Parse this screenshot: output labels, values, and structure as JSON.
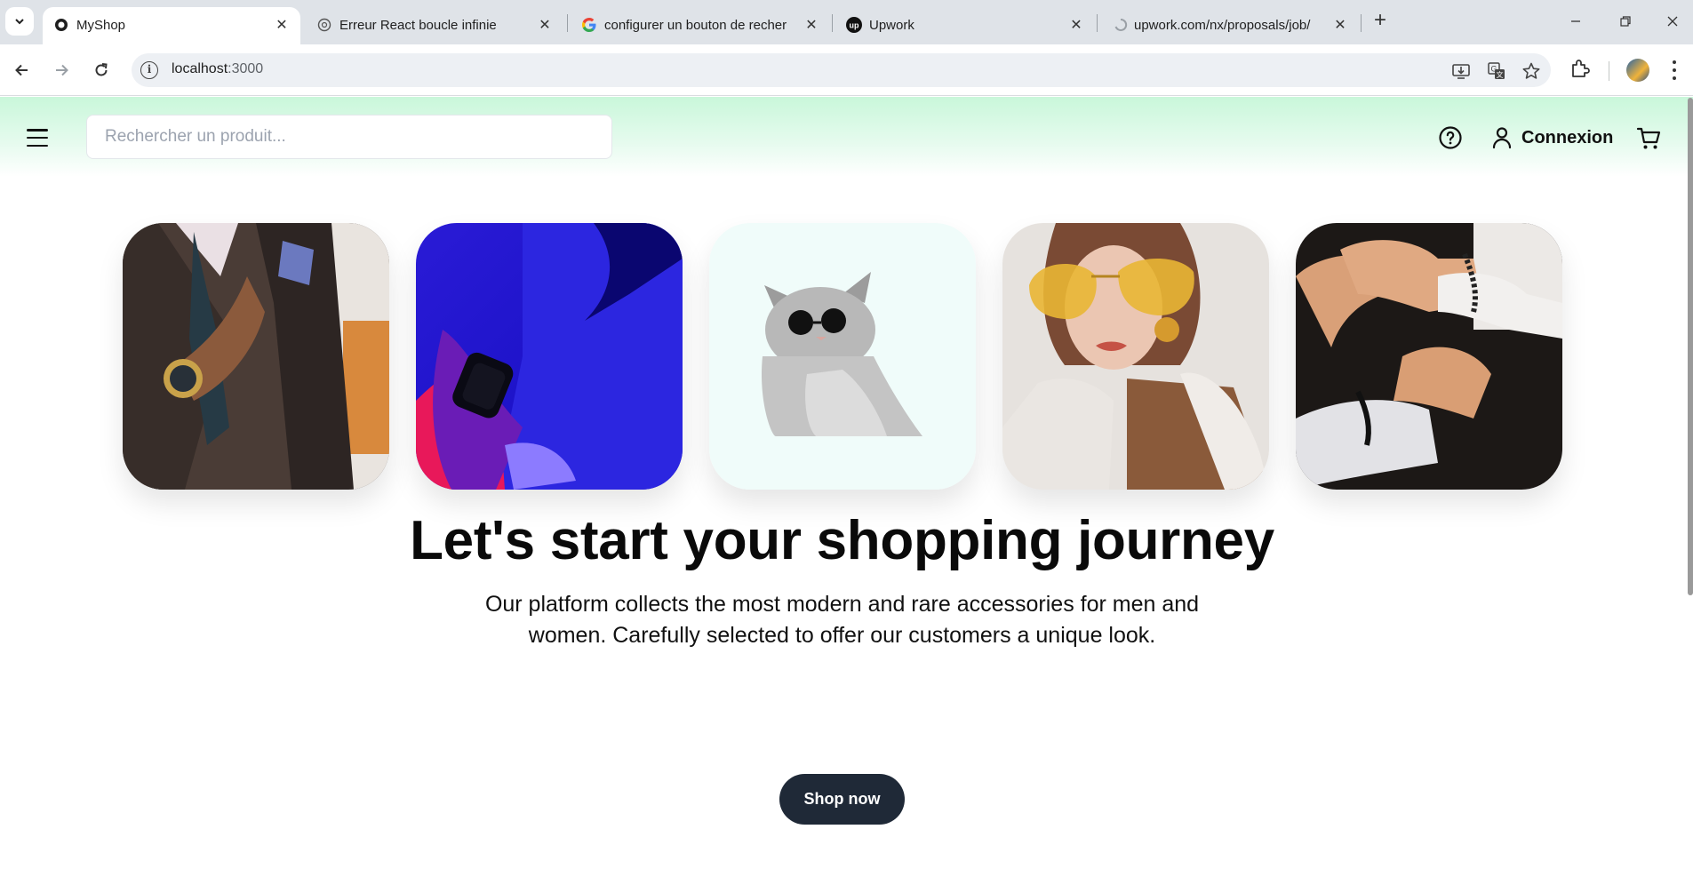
{
  "browser": {
    "tabs": [
      {
        "title": "MyShop",
        "active": true,
        "favicon": "myshop-favicon"
      },
      {
        "title": "Erreur React boucle infinie",
        "active": false,
        "favicon": "chatgpt-favicon"
      },
      {
        "title": "configurer un bouton de recher",
        "active": false,
        "favicon": "google-favicon"
      },
      {
        "title": "Upwork",
        "active": false,
        "favicon": "upwork-favicon"
      },
      {
        "title": "upwork.com/nx/proposals/job/",
        "active": false,
        "favicon": "loading-favicon"
      }
    ],
    "url_host": "localhost",
    "url_port": ":3000"
  },
  "header": {
    "search_placeholder": "Rechercher un produit...",
    "login_label": "Connexion"
  },
  "cards": [
    {
      "subject": "man in suit wearing wristwatch"
    },
    {
      "subject": "smartwatch in blue neon light"
    },
    {
      "subject": "cat wearing sunglasses"
    },
    {
      "subject": "woman with yellow sunglasses"
    },
    {
      "subject": "hands adjusting bracelets"
    }
  ],
  "hero": {
    "title": "Let's start your shopping journey",
    "subtitle": "Our platform collects the most modern and rare accessories for men and women. Carefully selected to offer our customers a unique look.",
    "cta_label": "Shop now"
  },
  "colors": {
    "header_gradient": "#c9f7da",
    "cta_background": "#1f2937",
    "cat_card_background": "#f0fcfa"
  }
}
